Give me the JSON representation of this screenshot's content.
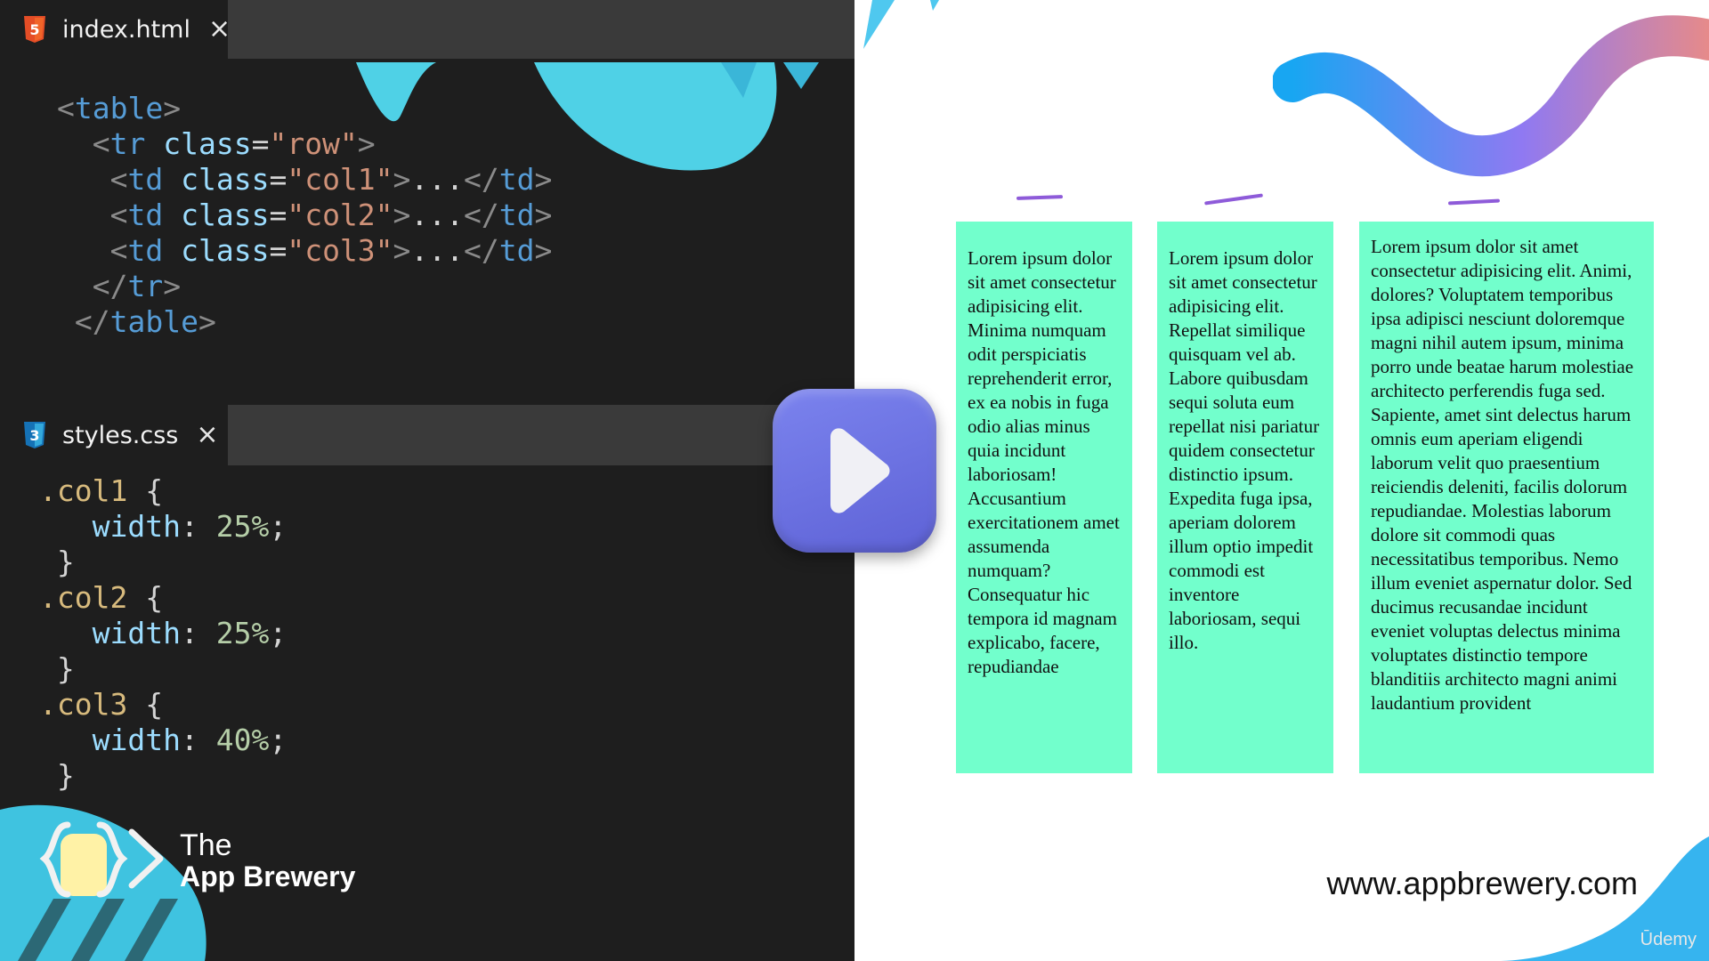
{
  "editor": {
    "html_tab": {
      "filename": "index.html",
      "icon": "html5-icon"
    },
    "css_tab": {
      "filename": "styles.css",
      "icon": "css3-icon"
    },
    "html_code": [
      [
        [
          "punc",
          "<"
        ],
        [
          "tag",
          "table"
        ],
        [
          "punc",
          ">"
        ]
      ],
      [
        [
          "punc",
          "  <"
        ],
        [
          "tag",
          "tr"
        ],
        [
          "text",
          " "
        ],
        [
          "attr",
          "class"
        ],
        [
          "text",
          "="
        ],
        [
          "str",
          "\"row\""
        ],
        [
          "punc",
          ">"
        ]
      ],
      [
        [
          "punc",
          "   <"
        ],
        [
          "tag",
          "td"
        ],
        [
          "text",
          " "
        ],
        [
          "attr",
          "class"
        ],
        [
          "text",
          "="
        ],
        [
          "str",
          "\"col1\""
        ],
        [
          "punc",
          ">"
        ],
        [
          "text",
          "..."
        ],
        [
          "punc",
          "</"
        ],
        [
          "tag",
          "td"
        ],
        [
          "punc",
          ">"
        ]
      ],
      [
        [
          "punc",
          "   <"
        ],
        [
          "tag",
          "td"
        ],
        [
          "text",
          " "
        ],
        [
          "attr",
          "class"
        ],
        [
          "text",
          "="
        ],
        [
          "str",
          "\"col2\""
        ],
        [
          "punc",
          ">"
        ],
        [
          "text",
          "..."
        ],
        [
          "punc",
          "</"
        ],
        [
          "tag",
          "td"
        ],
        [
          "punc",
          ">"
        ]
      ],
      [
        [
          "punc",
          "   <"
        ],
        [
          "tag",
          "td"
        ],
        [
          "text",
          " "
        ],
        [
          "attr",
          "class"
        ],
        [
          "text",
          "="
        ],
        [
          "str",
          "\"col3\""
        ],
        [
          "punc",
          ">"
        ],
        [
          "text",
          "..."
        ],
        [
          "punc",
          "</"
        ],
        [
          "tag",
          "td"
        ],
        [
          "punc",
          ">"
        ]
      ],
      [
        [
          "punc",
          "  </"
        ],
        [
          "tag",
          "tr"
        ],
        [
          "punc",
          ">"
        ]
      ],
      [
        [
          "punc",
          " </"
        ],
        [
          "tag",
          "table"
        ],
        [
          "punc",
          ">"
        ]
      ]
    ],
    "css_code": [
      [
        [
          "sel",
          ".col1"
        ],
        [
          "text",
          " {"
        ]
      ],
      [
        [
          "prop",
          "   width"
        ],
        [
          "text",
          ": "
        ],
        [
          "num",
          "25%"
        ],
        [
          "text",
          ";"
        ]
      ],
      [
        [
          "text",
          " }"
        ]
      ],
      [
        [
          "sel",
          ".col2"
        ],
        [
          "text",
          " {"
        ]
      ],
      [
        [
          "prop",
          "   width"
        ],
        [
          "text",
          ": "
        ],
        [
          "num",
          "25%"
        ],
        [
          "text",
          ";"
        ]
      ],
      [
        [
          "text",
          " }"
        ]
      ],
      [
        [
          "sel",
          ".col3"
        ],
        [
          "text",
          " {"
        ]
      ],
      [
        [
          "prop",
          "   width"
        ],
        [
          "text",
          ": "
        ],
        [
          "num",
          "40%"
        ],
        [
          "text",
          ";"
        ]
      ],
      [
        [
          "text",
          " }"
        ]
      ]
    ]
  },
  "brand": {
    "line1": "The",
    "line2": "App Brewery"
  },
  "preview": {
    "columns": [
      {
        "name": "col1",
        "text": "Lorem ipsum dolor sit amet consectetur adipisicing elit. Minima numquam odit perspiciatis reprehenderit error, ex ea nobis in fuga odio alias minus quia incidunt laboriosam! Accusantium exercitationem amet assumenda numquam? Consequatur hic tempora id magnam explicabo, facere, repudiandae"
      },
      {
        "name": "col2",
        "text": "Lorem ipsum dolor sit amet consectetur adipisicing elit. Repellat similique quisquam vel ab. Labore quibusdam sequi soluta eum repellat nisi pariatur quidem consectetur distinctio ipsum. Expedita fuga ipsa, aperiam dolorem illum optio impedit commodi est inventore laboriosam, sequi illo."
      },
      {
        "name": "col3",
        "text": "Lorem ipsum dolor sit amet consectetur adipisicing elit. Animi, dolores? Voluptatem temporibus ipsa adipisci nesciunt doloremque magni nihil autem ipsum, minima porro unde beatae harum molestiae architecto perferendis fuga sed. Sapiente, amet sint delectus harum omnis eum aperiam eligendi laborum velit quo praesentium reiciendis deleniti, facilis dolorum repudiandae. Molestias laborum dolore sit commodi quas necessitatibus temporibus. Nemo illum eveniet aspernatur dolor. Sed ducimus recusandae incidunt eveniet voluptas delectus minima voluptates distinctio tempore blanditiis architecto magni animi laudantium provident"
      }
    ],
    "website": "www.appbrewery.com",
    "watermark": "Ūdemy"
  },
  "colors": {
    "editor_bg": "#1e1e1e",
    "column_bg": "#72ffcc",
    "play_button": "#6a6fe0",
    "annotation": "#8e5bd9",
    "accent_cyan": "#4fd1e6"
  }
}
